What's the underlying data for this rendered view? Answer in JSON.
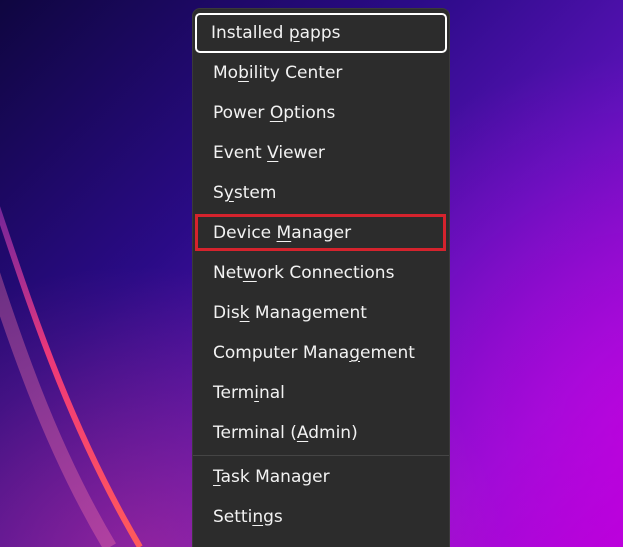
{
  "menu": {
    "items": [
      {
        "pre": "Installed ",
        "u": "",
        "post": "apps",
        "accent": "p"
      },
      {
        "pre": "Mo",
        "u": "b",
        "post": "ility Center"
      },
      {
        "pre": "Power ",
        "u": "O",
        "post": "ptions"
      },
      {
        "pre": "Event ",
        "u": "V",
        "post": "iewer"
      },
      {
        "pre": "S",
        "u": "y",
        "post": "stem"
      },
      {
        "pre": "Device ",
        "u": "M",
        "post": "anager"
      },
      {
        "pre": "Net",
        "u": "w",
        "post": "ork Connections"
      },
      {
        "pre": "Dis",
        "u": "k",
        "post": " Management"
      },
      {
        "pre": "Computer Mana",
        "u": "g",
        "post": "ement"
      },
      {
        "pre": "Term",
        "u": "i",
        "post": "nal"
      },
      {
        "pre": "Terminal (",
        "u": "A",
        "post": "dmin)"
      }
    ],
    "bottom_items": [
      {
        "pre": "",
        "u": "T",
        "post": "ask Manager"
      },
      {
        "pre": "Setti",
        "u": "n",
        "post": "gs"
      }
    ]
  },
  "colors": {
    "menu_bg": "#2c2c2c",
    "highlight": "#d5232d"
  }
}
